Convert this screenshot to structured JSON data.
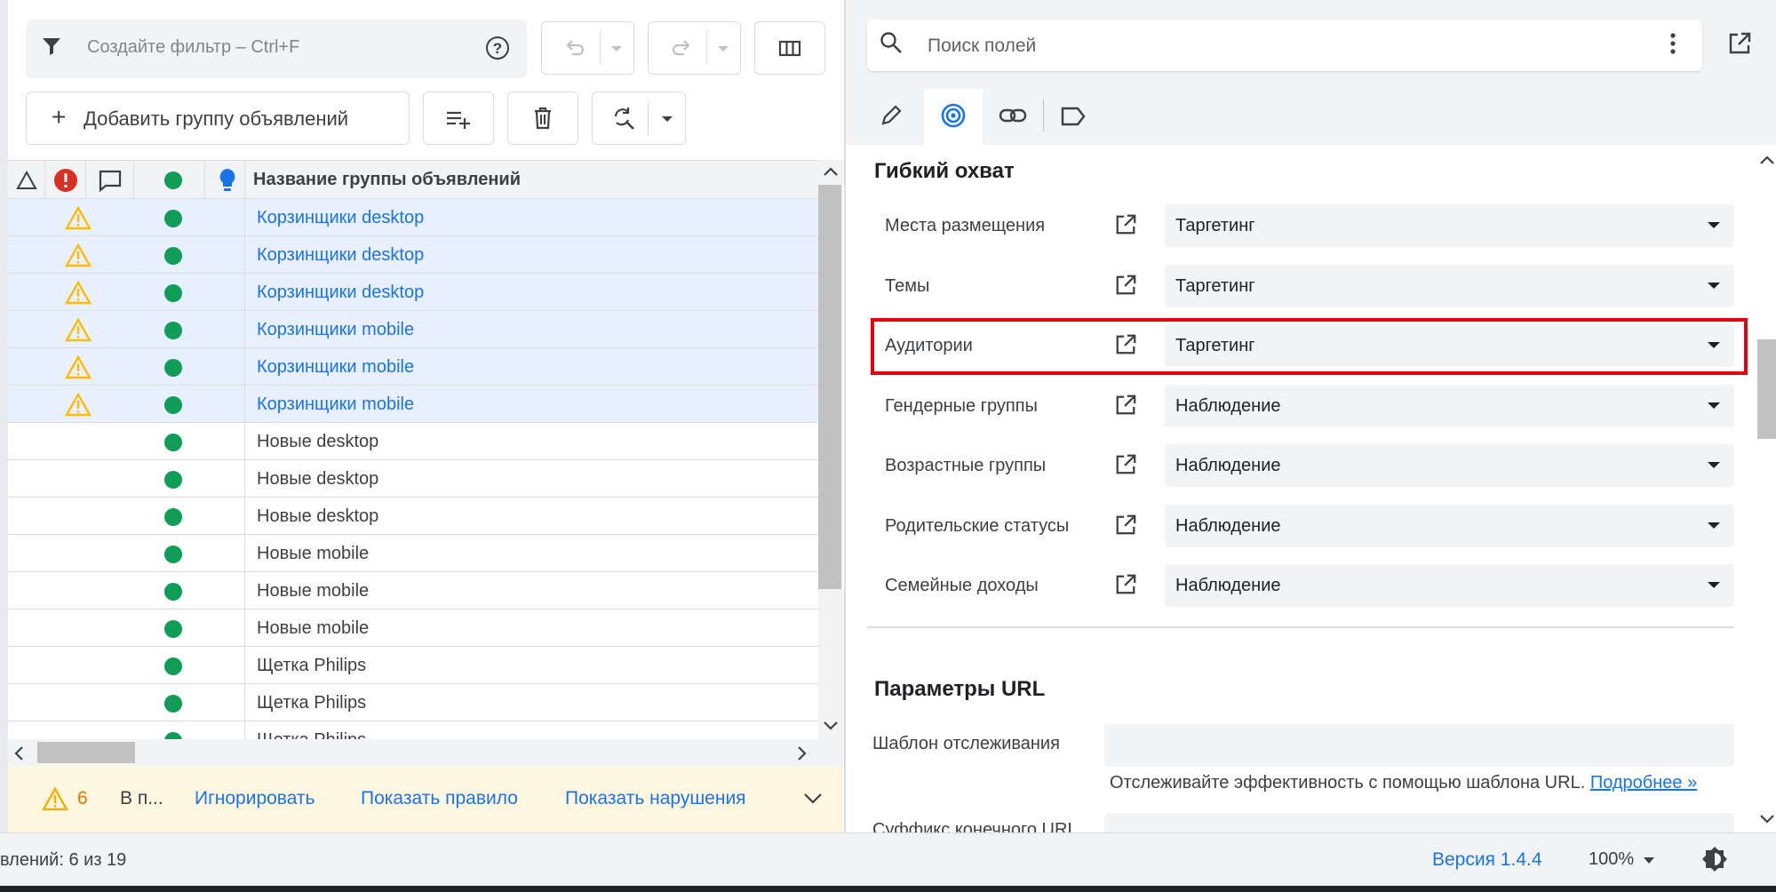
{
  "filter": {
    "placeholder": "Создайте фильтр – Ctrl+F"
  },
  "toolbar": {
    "add_group_label": "Добавить группу объявлений"
  },
  "grid": {
    "header_title": "Название группы объявлений",
    "rows": [
      {
        "name": "Корзинщики desktop",
        "selected": true,
        "warning": true
      },
      {
        "name": "Корзинщики desktop",
        "selected": true,
        "warning": true
      },
      {
        "name": "Корзинщики desktop",
        "selected": true,
        "warning": true
      },
      {
        "name": "Корзинщики mobile",
        "selected": true,
        "warning": true
      },
      {
        "name": "Корзинщики mobile",
        "selected": true,
        "warning": true
      },
      {
        "name": "Корзинщики mobile",
        "selected": true,
        "warning": true
      },
      {
        "name": "Новые desktop",
        "selected": false,
        "warning": false
      },
      {
        "name": "Новые desktop",
        "selected": false,
        "warning": false
      },
      {
        "name": "Новые desktop",
        "selected": false,
        "warning": false
      },
      {
        "name": "Новые mobile",
        "selected": false,
        "warning": false
      },
      {
        "name": "Новые mobile",
        "selected": false,
        "warning": false
      },
      {
        "name": "Новые mobile",
        "selected": false,
        "warning": false
      },
      {
        "name": "Щетка Philips",
        "selected": false,
        "warning": false
      },
      {
        "name": "Щетка Philips",
        "selected": false,
        "warning": false
      },
      {
        "name": "Щетка Philips",
        "selected": false,
        "warning": false
      }
    ]
  },
  "warnings": {
    "count": "6",
    "text": "В п...",
    "ignore": "Игнорировать",
    "show_rule": "Показать правило",
    "show_violations": "Показать нарушения"
  },
  "right": {
    "search_placeholder": "Поиск полей",
    "reach": {
      "title": "Гибкий охват",
      "rows": [
        {
          "label": "Места размещения",
          "value": "Таргетинг"
        },
        {
          "label": "Темы",
          "value": "Таргетинг"
        },
        {
          "label": "Аудитории",
          "value": "Таргетинг"
        },
        {
          "label": "Гендерные группы",
          "value": "Наблюдение"
        },
        {
          "label": "Возрастные группы",
          "value": "Наблюдение"
        },
        {
          "label": "Родительские статусы",
          "value": "Наблюдение"
        },
        {
          "label": "Семейные доходы",
          "value": "Наблюдение"
        }
      ]
    },
    "url": {
      "title": "Параметры URL",
      "tracking_label": "Шаблон отслеживания",
      "help_text": "Отслеживайте эффективность с помощью шаблона URL.",
      "more_link": "Подробнее »",
      "suffix_label": "Суффикс конечного URL"
    }
  },
  "status": {
    "count_text": "влений: 6 из 19",
    "version": "Версия 1.4.4",
    "zoom": "100%"
  },
  "colors": {
    "selected_row": "#e8f0fe",
    "link": "#1a73e8",
    "highlight_border": "#e8000d",
    "status_dot": "#0f9d58",
    "warning": "#fbbc04"
  }
}
